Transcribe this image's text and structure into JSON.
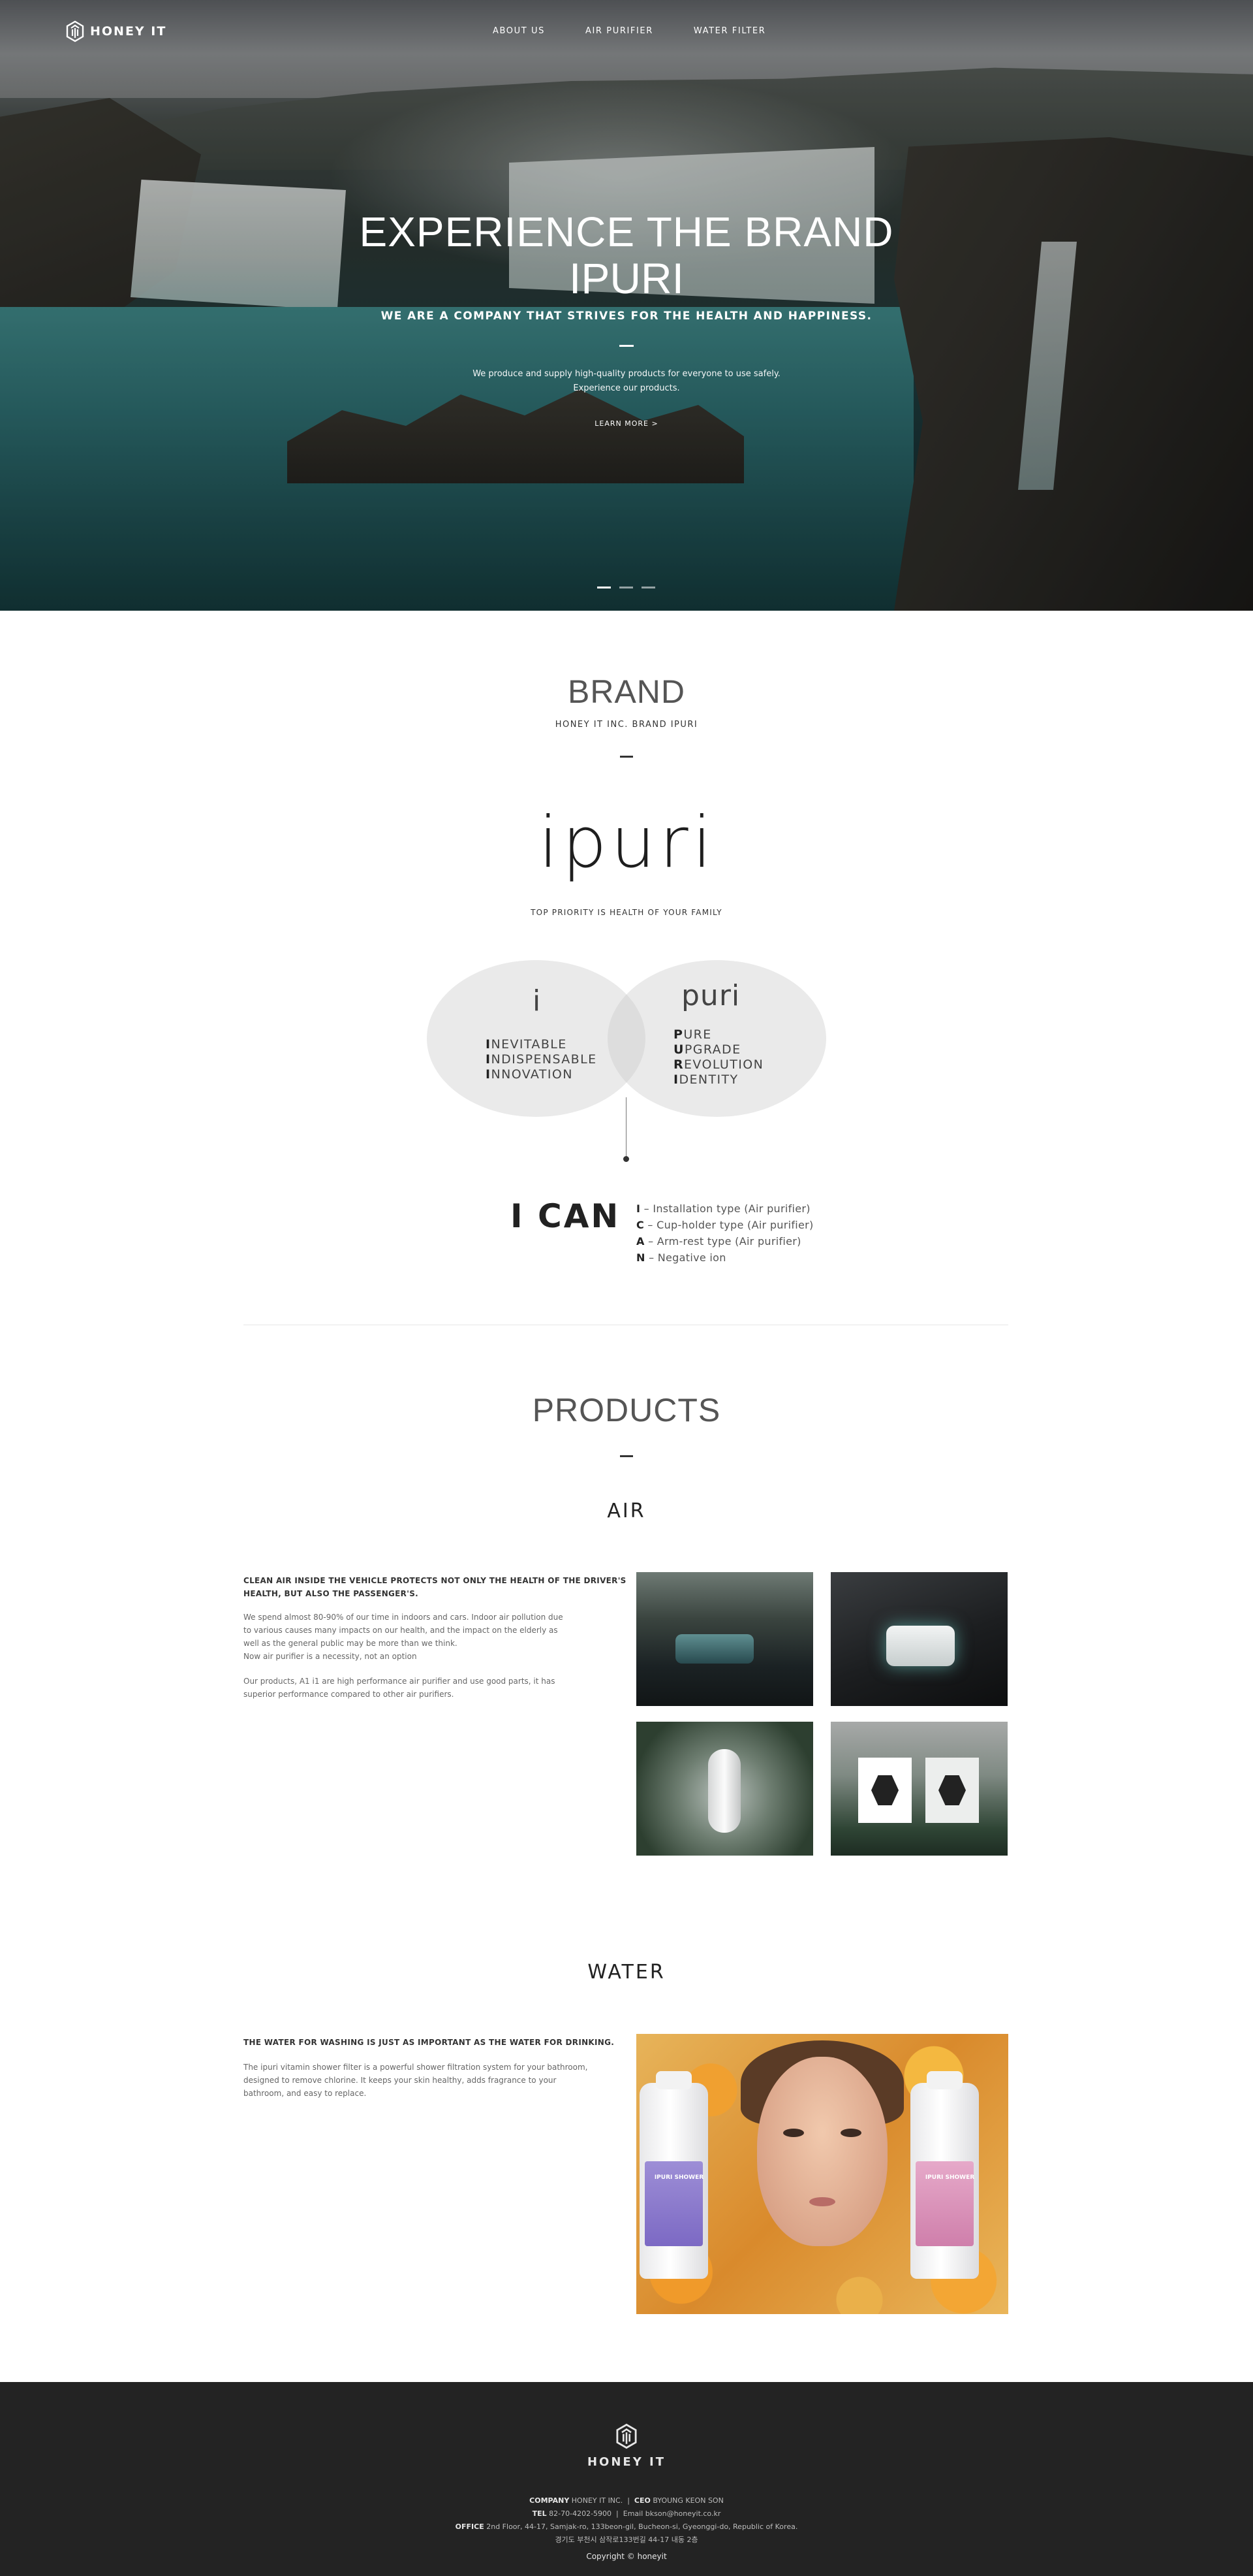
{
  "nav": {
    "brand": "HONEY IT",
    "items": [
      {
        "label": "ABOUT US"
      },
      {
        "label": "AIR PURIFIER"
      },
      {
        "label": "WATER FILTER"
      }
    ]
  },
  "hero": {
    "line1": "EXPERIENCE THE BRAND",
    "line2": "IPURI",
    "subtitle": "WE ARE A COMPANY THAT STRIVES FOR THE HEALTH AND HAPPINESS.",
    "desc1": "We produce and supply high-quality products for everyone to use safely.",
    "desc2": "Experience our products.",
    "cta": "LEARN MORE >",
    "slides": 3,
    "active_slide": 1
  },
  "brand": {
    "title": "BRAND",
    "subtitle": "HONEY IT INC. BRAND IPURI",
    "logo_text": "ipuri",
    "tagline": "TOP PRIORITY IS HEALTH OF YOUR FAMILY",
    "left_title": "i",
    "left_words": [
      {
        "initial": "I",
        "rest": "NEVITABLE"
      },
      {
        "initial": "I",
        "rest": "NDISPENSABLE"
      },
      {
        "initial": "I",
        "rest": "NNOVATION"
      }
    ],
    "right_title": "puri",
    "right_words": [
      {
        "initial": "P",
        "rest": "URE"
      },
      {
        "initial": "U",
        "rest": "PGRADE"
      },
      {
        "initial": "R",
        "rest": "EVOLUTION"
      },
      {
        "initial": "I",
        "rest": "DENTITY"
      }
    ],
    "ican": "I CAN",
    "ican_items": [
      {
        "letter": "I",
        "text": " – Installation type (Air purifier)"
      },
      {
        "letter": "C",
        "text": " – Cup-holder type (Air purifier)"
      },
      {
        "letter": "A",
        "text": " – Arm-rest type (Air purifier)"
      },
      {
        "letter": "N",
        "text": " – Negative ion"
      }
    ]
  },
  "products": {
    "title": "PRODUCTS",
    "air": {
      "label": "AIR",
      "heading1": "CLEAN AIR INSIDE THE VEHICLE PROTECTS NOT ONLY THE HEALTH OF THE DRIVER'S",
      "heading2": "HEALTH, BUT ALSO THE PASSENGER'S.",
      "p1": "We spend almost 80-90% of our time in indoors and cars. Indoor air pollution due",
      "p2": "to various causes many impacts on our health, and the impact on the elderly as",
      "p3": "well as the general public may be more than we think.",
      "p4": "Now air purifier is a necessity, not an option",
      "p5": "Our products, A1 i1 are high performance air purifier and use good parts, it has",
      "p6": "superior performance compared to other air purifiers."
    },
    "water": {
      "label": "WATER",
      "heading": "THE WATER FOR WASHING IS JUST AS IMPORTANT AS THE WATER FOR DRINKING.",
      "p1": "The ipuri vitamin shower filter is a powerful shower filtration system for your bathroom,",
      "p2": "designed to remove chlorine. It keeps your skin healthy, adds fragrance to your",
      "p3": "bathroom, and easy to replace.",
      "bottle_left": "IPURI SHOWER",
      "bottle_right": "IPURI SHOWER"
    }
  },
  "footer": {
    "brand": "HONEY IT",
    "company_label": "COMPANY",
    "company": "HONEY IT INC.",
    "ceo_label": "CEO",
    "ceo": "BYOUNG KEON SON",
    "tel_label": "TEL",
    "tel": "82-70-4202-5900",
    "email_label": "Email",
    "email": "bkson@honeyit.co.kr",
    "office_label": "OFFICE",
    "office": "2nd Floor, 44-17, Samjak-ro, 133beon-gil, Bucheon-si, Gyeonggi-do, Republic of Korea.",
    "office_kr": "경기도 부천시 삼작로133번길 44-17 내동 2층",
    "copyright": "Copyright © honeyit"
  },
  "colors": {
    "footer_bg": "#232323",
    "text_dark": "#222222",
    "venn_fill": "#e3e3e3"
  }
}
